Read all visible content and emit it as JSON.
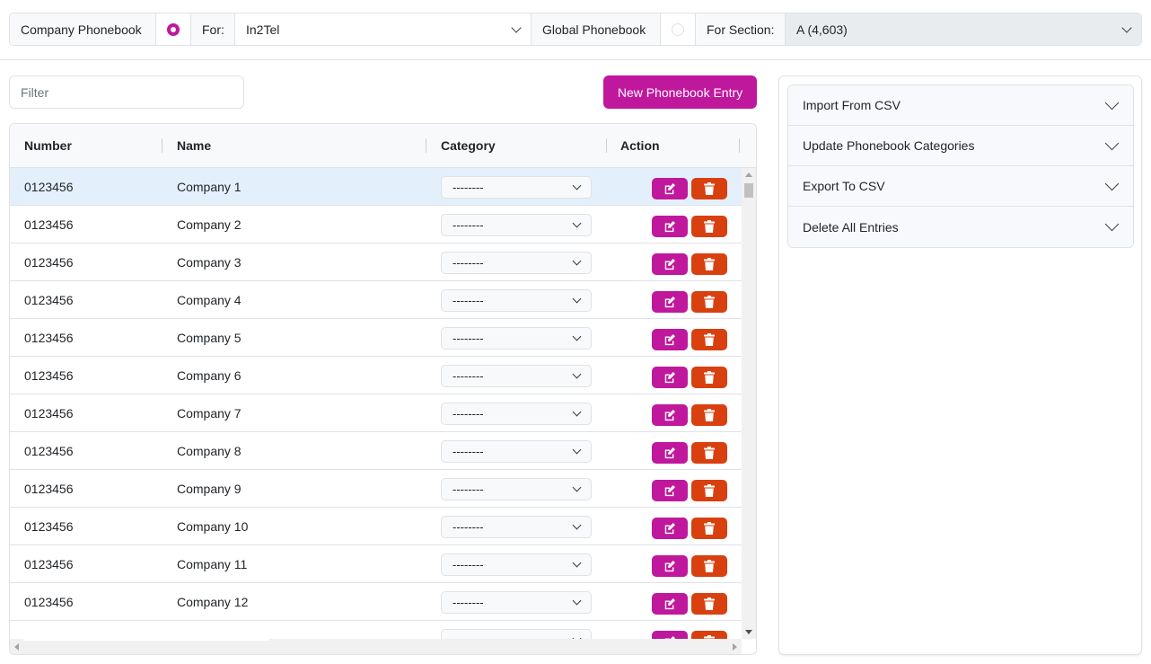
{
  "topbar": {
    "company_label": "Company Phonebook",
    "company_selected": true,
    "for_label": "For:",
    "for_value": "In2Tel",
    "global_label": "Global Phonebook",
    "global_selected": false,
    "section_label": "For Section:",
    "section_value": "A (4,603)"
  },
  "toolbar": {
    "filter_placeholder": "Filter",
    "filter_value": "",
    "new_entry_label": "New Phonebook Entry"
  },
  "grid": {
    "columns": [
      "Number",
      "Name",
      "Category",
      "Action"
    ],
    "rows": [
      {
        "number": "0123456",
        "name": "Company 1",
        "category": "--------",
        "selected": true
      },
      {
        "number": "0123456",
        "name": "Company 2",
        "category": "--------"
      },
      {
        "number": "0123456",
        "name": "Company 3",
        "category": "--------"
      },
      {
        "number": "0123456",
        "name": "Company 4",
        "category": "--------"
      },
      {
        "number": "0123456",
        "name": "Company 5",
        "category": "--------"
      },
      {
        "number": "0123456",
        "name": "Company 6",
        "category": "--------"
      },
      {
        "number": "0123456",
        "name": "Company 7",
        "category": "--------"
      },
      {
        "number": "0123456",
        "name": "Company 8",
        "category": "--------"
      },
      {
        "number": "0123456",
        "name": "Company 9",
        "category": "--------"
      },
      {
        "number": "0123456",
        "name": "Company 10",
        "category": "--------"
      },
      {
        "number": "0123456",
        "name": "Company 11",
        "category": "--------"
      },
      {
        "number": "0123456",
        "name": "Company 12",
        "category": "--------"
      },
      {
        "number": "",
        "name": "",
        "category": "--------"
      }
    ],
    "icons": {
      "edit": "edit-icon",
      "delete": "trash-icon"
    }
  },
  "panel": {
    "accordion": [
      {
        "label": "Import From CSV"
      },
      {
        "label": "Update Phonebook Categories"
      },
      {
        "label": "Export To CSV"
      },
      {
        "label": "Delete All Entries"
      }
    ]
  },
  "colors": {
    "accent": "#c0189d",
    "danger": "#d9400f",
    "selected_row": "#e3f0fc"
  }
}
